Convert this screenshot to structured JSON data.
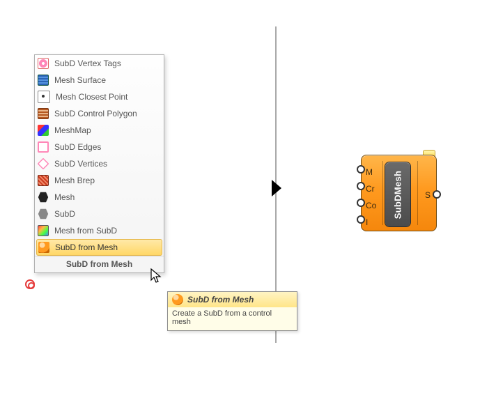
{
  "menu": {
    "items": [
      {
        "label": "SubD Vertex Tags",
        "icon": "pink-circle-icon"
      },
      {
        "label": "Mesh Surface",
        "icon": "grid-blue-icon"
      },
      {
        "label": "Mesh Closest Point",
        "icon": "dot-icon"
      },
      {
        "label": "SubD Control Polygon",
        "icon": "brown-grid-icon"
      },
      {
        "label": "MeshMap",
        "icon": "meshmap-icon"
      },
      {
        "label": "SubD Edges",
        "icon": "pink-square-icon"
      },
      {
        "label": "SubD Vertices",
        "icon": "pink-diamond-icon"
      },
      {
        "label": "Mesh Brep",
        "icon": "red-grid-icon"
      },
      {
        "label": "Mesh",
        "icon": "black-hex-icon"
      },
      {
        "label": "SubD",
        "icon": "grey-hex-icon"
      },
      {
        "label": "Mesh from SubD",
        "icon": "mesh-rainbow-icon"
      },
      {
        "label": "SubD from Mesh",
        "icon": "orange-sphere-icon",
        "selected": true
      }
    ],
    "footer": "SubD from Mesh"
  },
  "tooltip": {
    "title": "SubD from Mesh",
    "body": "Create a SubD from a control mesh"
  },
  "node": {
    "name": "SubDMesh",
    "inputs": [
      "M",
      "Cr",
      "Co",
      "I"
    ],
    "outputs": [
      "S"
    ]
  }
}
